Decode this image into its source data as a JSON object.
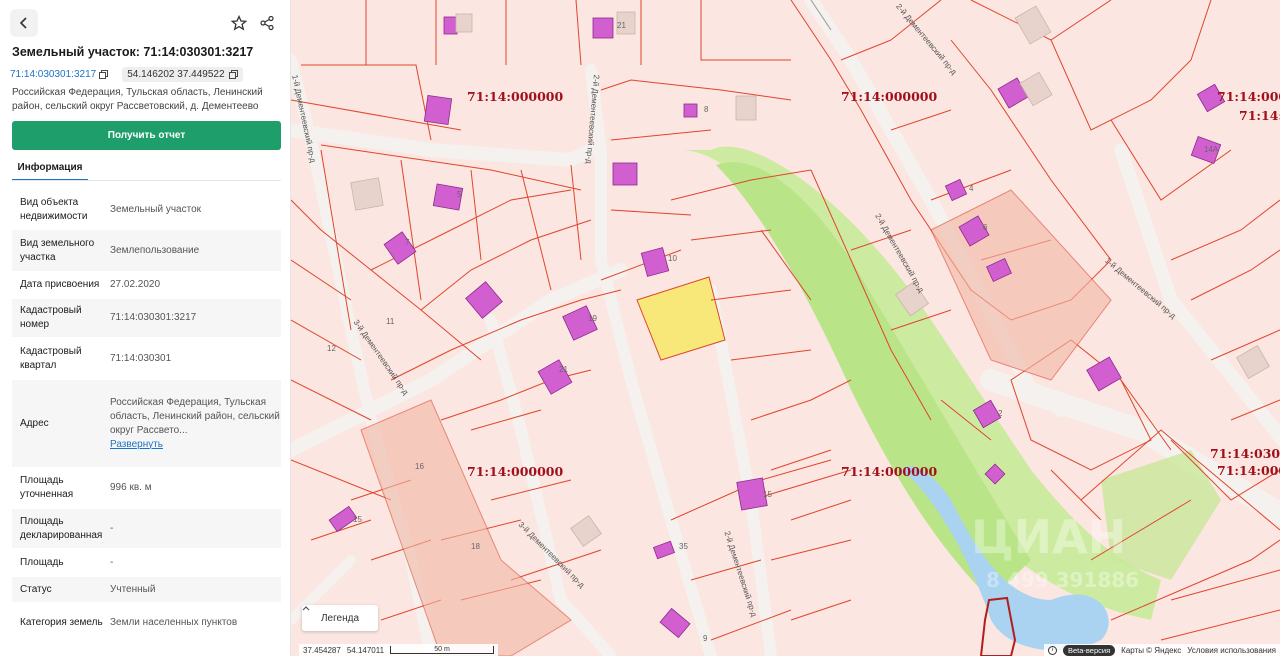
{
  "sidebar": {
    "title": "Земельный участок: 71:14:030301:3217",
    "cad_chip": "71:14:030301:3217",
    "coords_chip": "54.146202 37.449522",
    "address": "Российская Федерация, Тульская область, Ленинский район, сельский округ Рассветовский, д. Дементеево",
    "report_button": "Получить отчет",
    "tab_info": "Информация",
    "rows": [
      {
        "key": "Вид объекта недвижимости",
        "value": "Земельный участок"
      },
      {
        "key": "Вид земельного участка",
        "value": "Землепользование"
      },
      {
        "key": "Дата присвоения",
        "value": "27.02.2020"
      },
      {
        "key": "Кадастровый номер",
        "value": "71:14:030301:3217"
      },
      {
        "key": "Кадастровый квартал",
        "value": "71:14:030301"
      },
      {
        "key": "Адрес",
        "value": "Российская Федерация, Тульская область, Ленинский район, сельский округ Рассвето...",
        "link": "Развернуть"
      },
      {
        "key": "Площадь уточненная",
        "value": "996 кв. м"
      },
      {
        "key": "Площадь декларированная",
        "value": "-"
      },
      {
        "key": "Площадь",
        "value": "-"
      },
      {
        "key": "Статус",
        "value": "Учтенный"
      },
      {
        "key": "Категория земель",
        "value": "Земли населенных пунктов"
      }
    ]
  },
  "map": {
    "cad_labels": [
      "71:14:000000",
      "71:14:000000",
      "71:14:000000",
      "71:14:000000",
      "71:14:000000",
      "71:14:0303",
      "71:14:000000",
      "71:14:000000",
      "71:14:03"
    ],
    "house_numbers": [
      "21",
      "8",
      "4",
      "6",
      "10",
      "7",
      "11",
      "12",
      "19",
      "21",
      "16",
      "15",
      "18",
      "35",
      "15",
      "2",
      "14А",
      "5",
      "9"
    ],
    "streets": [
      "1-й Дементеевский пр-д",
      "2-й Дементеевский пр-д",
      "2-й Дементеевский пр-д",
      "2-й Дементеевский пр-д",
      "2-й Дементеевский пр-д",
      "3-й Дементеевский пр-д",
      "3-й Дементеевский пр-д",
      "1-й Дементеевский пр-д",
      "2-й Дементеевский пр-д"
    ],
    "legend_button": "Легенда",
    "coord_lon": "37.454287",
    "coord_lat": "54.147011",
    "scale_label": "50 m",
    "beta_badge": "Beta-версия",
    "copyright": "Карты © Яндекс",
    "terms": "Условия использования",
    "watermark_text": "ЦИАН",
    "watermark_phone": "8 499 391886",
    "colors": {
      "parcel_fill": "#fbe6e1",
      "parcel_border": "#e0452b",
      "road": "#f4f1ee",
      "park": "#c6eb9a",
      "water": "#a9d3f0",
      "selected": "#f8e87a",
      "building": "#d25fd0"
    }
  }
}
